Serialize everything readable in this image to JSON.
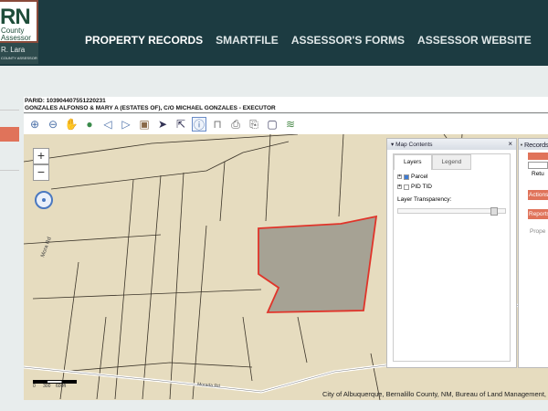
{
  "header": {
    "logo_letters": "RN",
    "logo_line1": "County",
    "logo_line2": "Assessor",
    "logo_name": "R. Lara",
    "logo_sub": "COUNTY ASSESSOR",
    "nav": [
      "PROPERTY RECORDS",
      "SMARTFILE",
      "ASSESSOR'S FORMS",
      "ASSESSOR WEBSITE"
    ]
  },
  "parcel": {
    "parid": "PARID: 103904407551220231",
    "owner": "GONZALES ALFONSO & MARY A (ESTATES OF), C/O MICHAEL GONZALES - EXECUTOR"
  },
  "toolbar": [
    "zoom-in",
    "zoom-out",
    "pan",
    "full-extent",
    "back",
    "forward",
    "map-layers",
    "select",
    "select-by",
    "identify",
    "measure",
    "print",
    "print-preview",
    "zoom-box",
    "layers"
  ],
  "map": {
    "zoom_in": "+",
    "zoom_out": "−",
    "attribution": "City of Albuquerque, Bernalillo County, NM, Bureau of Land Management,",
    "scale": [
      "0",
      "300",
      "600ft"
    ],
    "roads": [
      "Mora Rd",
      "Morada Rd"
    ],
    "parcel_color": "#e0342a"
  },
  "map_contents": {
    "title": "Map Contents",
    "close": "×",
    "tabs": [
      "Layers",
      "Legend"
    ],
    "layers": [
      {
        "name": "Parcel",
        "checked": true
      },
      {
        "name": "PID TID",
        "checked": false
      }
    ],
    "transparency_label": "Layer Transparency:"
  },
  "records": {
    "title": "Records",
    "return": "Retu",
    "actions": "Actions",
    "reports": "Reports",
    "prop": "Prope"
  }
}
